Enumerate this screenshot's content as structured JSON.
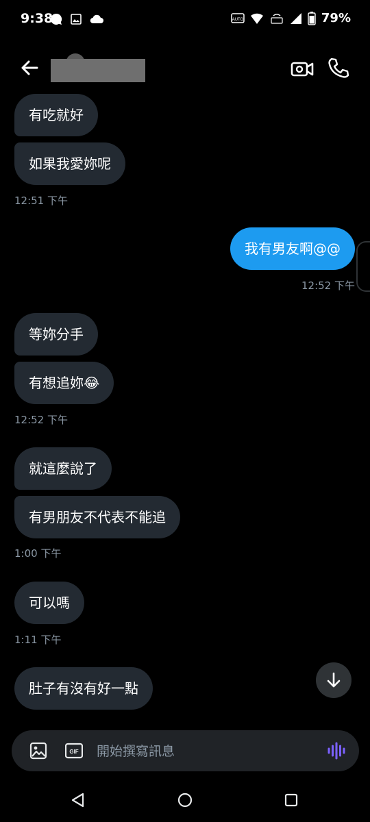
{
  "status_bar": {
    "time": "9:38",
    "battery_percent": "79%",
    "icons_left": [
      "chat-bubble-icon",
      "gallery-icon",
      "cloud-icon"
    ],
    "icons_right": [
      "auto-icon",
      "wifi-icon",
      "volte-icon",
      "signal-icon",
      "battery-icon"
    ]
  },
  "header": {
    "contact_name": "",
    "actions": [
      "video-call-icon",
      "phone-call-icon"
    ]
  },
  "messages": [
    {
      "dir": "in",
      "text": "有吃就好"
    },
    {
      "dir": "in",
      "text": "如果我愛妳呢"
    },
    {
      "dir": "in",
      "timestamp": "12:51 下午"
    },
    {
      "dir": "out",
      "text": "我有男友啊@@"
    },
    {
      "dir": "out",
      "timestamp": "12:52 下午"
    },
    {
      "dir": "in",
      "text": "等妳分手"
    },
    {
      "dir": "in",
      "text": "有想追妳",
      "emoji": "😂"
    },
    {
      "dir": "in",
      "timestamp": "12:52 下午"
    },
    {
      "dir": "in",
      "text": "就這麼說了"
    },
    {
      "dir": "in",
      "text": "有男朋友不代表不能追"
    },
    {
      "dir": "in",
      "timestamp": "1:00 下午"
    },
    {
      "dir": "in",
      "text": "可以嗎"
    },
    {
      "dir": "in",
      "timestamp": "1:11 下午"
    },
    {
      "dir": "in",
      "text": "肚子有沒有好一點"
    }
  ],
  "composer": {
    "placeholder": "開始撰寫訊息",
    "icons": [
      "image-icon",
      "gif-icon",
      "voice-icon"
    ]
  },
  "colors": {
    "background": "#000000",
    "incoming_bubble": "#232a32",
    "outgoing_bubble": "#1d9bf0",
    "timestamp": "#8b98a5",
    "voice_accent": "#7b61ff"
  }
}
